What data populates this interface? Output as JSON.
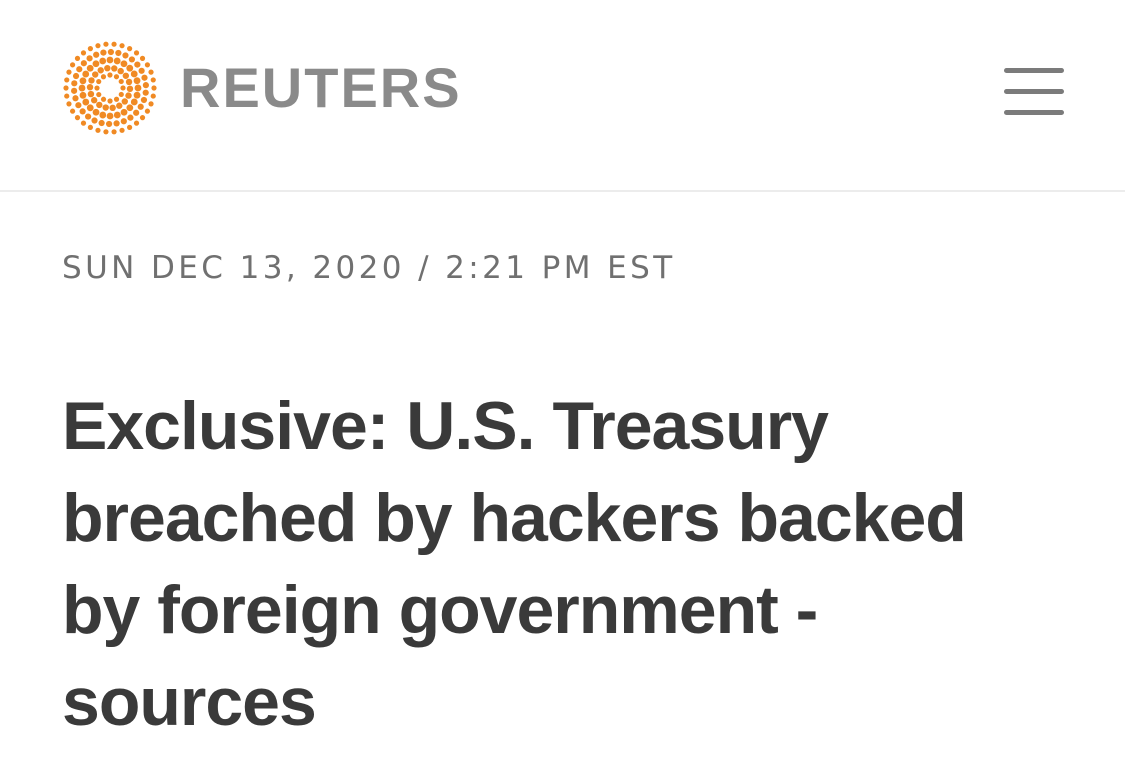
{
  "header": {
    "brand_name": "REUTERS",
    "logo_icon": "reuters-dot-ring-logo",
    "logo_color": "#f08a24",
    "menu_icon": "hamburger-menu-icon"
  },
  "article": {
    "dateline": "SUN DEC 13, 2020 / 2:21 PM EST",
    "headline_lines": [
      "Exclusive: U.S. Treasury",
      "breached by hackers backed",
      "by foreign government -",
      "sources"
    ]
  }
}
